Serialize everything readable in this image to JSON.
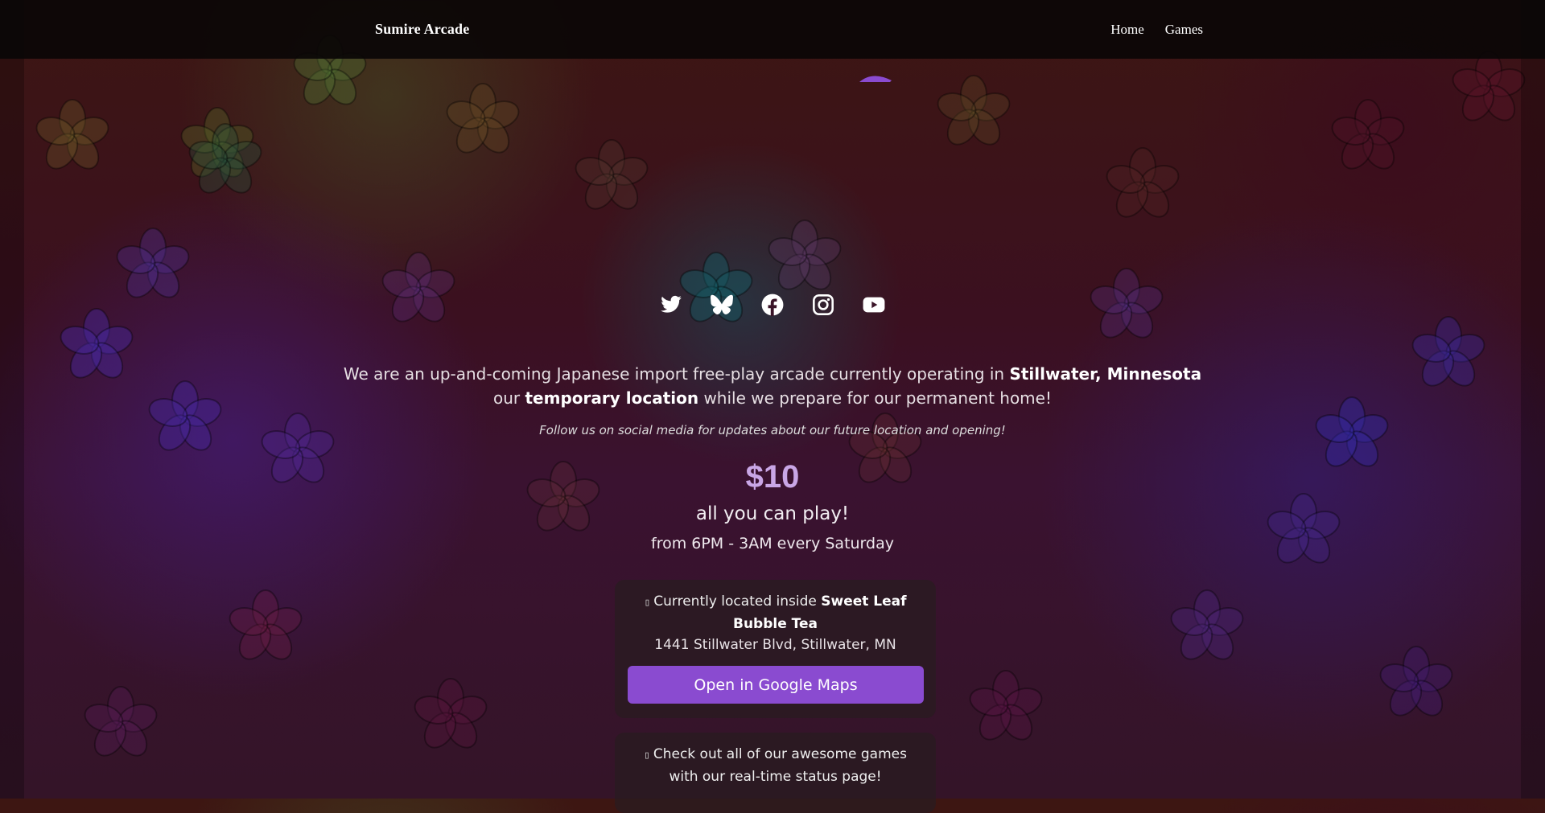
{
  "header": {
    "site_title": "Sumire Arcade",
    "nav": [
      {
        "label": "Home"
      },
      {
        "label": "Games"
      }
    ]
  },
  "socials": [
    {
      "icon": "twitter-icon"
    },
    {
      "icon": "bluesky-icon"
    },
    {
      "icon": "facebook-icon"
    },
    {
      "icon": "instagram-icon"
    },
    {
      "icon": "youtube-icon"
    }
  ],
  "intro": {
    "line1_pre": "We are an up-and-coming Japanese import free-play arcade currently operating in ",
    "line1_bold": "Stillwater, Minnesota",
    "line2_pre": "our ",
    "line2_bold": "temporary location",
    "line2_post": " while we prepare for our permanent home!"
  },
  "follow_text": "Follow us on social media for updates about our future location and opening!",
  "pricing": {
    "price": "$10",
    "tagline": "all you can play!",
    "hours": "from 6PM - 3AM every Saturday"
  },
  "location_card": {
    "prefix": "Currently located inside ",
    "venue": "Sweet Leaf Bubble Tea",
    "address": "1441 Stillwater Blvd, Stillwater, MN",
    "button_label": "Open in Google Maps"
  },
  "games_card": {
    "text": "Check out all of our awesome games with our real-time status page!"
  },
  "colors": {
    "accent": "#8a4bd0",
    "price": "#c9a6e6",
    "header_bg": "#0a0606"
  }
}
